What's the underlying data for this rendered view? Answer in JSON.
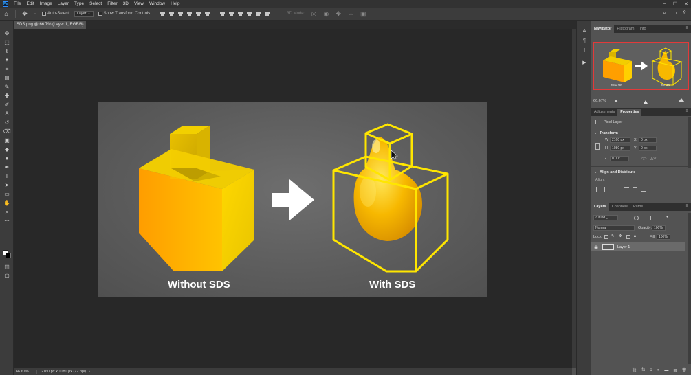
{
  "menu": {
    "logo": "Ps",
    "items": [
      "File",
      "Edit",
      "Image",
      "Layer",
      "Type",
      "Select",
      "Filter",
      "3D",
      "View",
      "Window",
      "Help"
    ],
    "window_controls": [
      "–",
      "☐",
      "✕"
    ]
  },
  "options": {
    "auto_select_label": "Auto-Select:",
    "auto_select_value": "Layer",
    "show_transform_label": "Show Transform Controls",
    "mode_3d_label": "3D Mode:"
  },
  "document": {
    "tab_title": "SDS.png @ 66.7% (Layer 1, RGB/8)",
    "close": "×"
  },
  "artboard": {
    "left_label": "Without SDS",
    "right_label": "With SDS",
    "accent_color": "#ffe600"
  },
  "status": {
    "zoom": "66.67%",
    "info": "2160 px x 1080 px (72 ppi)",
    "chevron": "›"
  },
  "navigator": {
    "tabs": [
      "Navigator",
      "Histogram",
      "Info"
    ],
    "zoom": "66.67%",
    "thumb_left_label": "Without SDS",
    "thumb_right_label": "With SDS"
  },
  "properties": {
    "tabs": [
      "Adjustments",
      "Properties"
    ],
    "layer_type": "Pixel Layer",
    "transform_header": "Transform",
    "w_label": "W",
    "w_value": "2160 px",
    "h_label": "H",
    "h_value": "1080 px",
    "x_label": "X",
    "x_value": "0 px",
    "y_label": "Y",
    "y_value": "0 px",
    "angle_value": "0.00°",
    "align_header": "Align and Distribute",
    "align_label": "Align:"
  },
  "layers": {
    "tabs": [
      "Layers",
      "Channels",
      "Paths"
    ],
    "filter_kind": "Kind",
    "blend_mode": "Normal",
    "opacity_label": "Opacity:",
    "opacity_value": "100%",
    "lock_label": "Lock:",
    "fill_label": "Fill:",
    "fill_value": "100%",
    "items": [
      {
        "name": "Layer 1"
      }
    ]
  }
}
